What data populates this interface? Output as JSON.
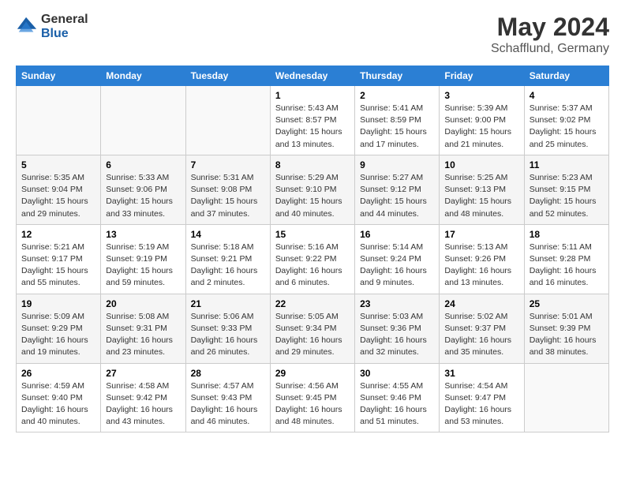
{
  "header": {
    "logo_general": "General",
    "logo_blue": "Blue",
    "month": "May 2024",
    "location": "Schafflund, Germany"
  },
  "weekdays": [
    "Sunday",
    "Monday",
    "Tuesday",
    "Wednesday",
    "Thursday",
    "Friday",
    "Saturday"
  ],
  "weeks": [
    [
      {
        "day": "",
        "info": ""
      },
      {
        "day": "",
        "info": ""
      },
      {
        "day": "",
        "info": ""
      },
      {
        "day": "1",
        "info": "Sunrise: 5:43 AM\nSunset: 8:57 PM\nDaylight: 15 hours\nand 13 minutes."
      },
      {
        "day": "2",
        "info": "Sunrise: 5:41 AM\nSunset: 8:59 PM\nDaylight: 15 hours\nand 17 minutes."
      },
      {
        "day": "3",
        "info": "Sunrise: 5:39 AM\nSunset: 9:00 PM\nDaylight: 15 hours\nand 21 minutes."
      },
      {
        "day": "4",
        "info": "Sunrise: 5:37 AM\nSunset: 9:02 PM\nDaylight: 15 hours\nand 25 minutes."
      }
    ],
    [
      {
        "day": "5",
        "info": "Sunrise: 5:35 AM\nSunset: 9:04 PM\nDaylight: 15 hours\nand 29 minutes."
      },
      {
        "day": "6",
        "info": "Sunrise: 5:33 AM\nSunset: 9:06 PM\nDaylight: 15 hours\nand 33 minutes."
      },
      {
        "day": "7",
        "info": "Sunrise: 5:31 AM\nSunset: 9:08 PM\nDaylight: 15 hours\nand 37 minutes."
      },
      {
        "day": "8",
        "info": "Sunrise: 5:29 AM\nSunset: 9:10 PM\nDaylight: 15 hours\nand 40 minutes."
      },
      {
        "day": "9",
        "info": "Sunrise: 5:27 AM\nSunset: 9:12 PM\nDaylight: 15 hours\nand 44 minutes."
      },
      {
        "day": "10",
        "info": "Sunrise: 5:25 AM\nSunset: 9:13 PM\nDaylight: 15 hours\nand 48 minutes."
      },
      {
        "day": "11",
        "info": "Sunrise: 5:23 AM\nSunset: 9:15 PM\nDaylight: 15 hours\nand 52 minutes."
      }
    ],
    [
      {
        "day": "12",
        "info": "Sunrise: 5:21 AM\nSunset: 9:17 PM\nDaylight: 15 hours\nand 55 minutes."
      },
      {
        "day": "13",
        "info": "Sunrise: 5:19 AM\nSunset: 9:19 PM\nDaylight: 15 hours\nand 59 minutes."
      },
      {
        "day": "14",
        "info": "Sunrise: 5:18 AM\nSunset: 9:21 PM\nDaylight: 16 hours\nand 2 minutes."
      },
      {
        "day": "15",
        "info": "Sunrise: 5:16 AM\nSunset: 9:22 PM\nDaylight: 16 hours\nand 6 minutes."
      },
      {
        "day": "16",
        "info": "Sunrise: 5:14 AM\nSunset: 9:24 PM\nDaylight: 16 hours\nand 9 minutes."
      },
      {
        "day": "17",
        "info": "Sunrise: 5:13 AM\nSunset: 9:26 PM\nDaylight: 16 hours\nand 13 minutes."
      },
      {
        "day": "18",
        "info": "Sunrise: 5:11 AM\nSunset: 9:28 PM\nDaylight: 16 hours\nand 16 minutes."
      }
    ],
    [
      {
        "day": "19",
        "info": "Sunrise: 5:09 AM\nSunset: 9:29 PM\nDaylight: 16 hours\nand 19 minutes."
      },
      {
        "day": "20",
        "info": "Sunrise: 5:08 AM\nSunset: 9:31 PM\nDaylight: 16 hours\nand 23 minutes."
      },
      {
        "day": "21",
        "info": "Sunrise: 5:06 AM\nSunset: 9:33 PM\nDaylight: 16 hours\nand 26 minutes."
      },
      {
        "day": "22",
        "info": "Sunrise: 5:05 AM\nSunset: 9:34 PM\nDaylight: 16 hours\nand 29 minutes."
      },
      {
        "day": "23",
        "info": "Sunrise: 5:03 AM\nSunset: 9:36 PM\nDaylight: 16 hours\nand 32 minutes."
      },
      {
        "day": "24",
        "info": "Sunrise: 5:02 AM\nSunset: 9:37 PM\nDaylight: 16 hours\nand 35 minutes."
      },
      {
        "day": "25",
        "info": "Sunrise: 5:01 AM\nSunset: 9:39 PM\nDaylight: 16 hours\nand 38 minutes."
      }
    ],
    [
      {
        "day": "26",
        "info": "Sunrise: 4:59 AM\nSunset: 9:40 PM\nDaylight: 16 hours\nand 40 minutes."
      },
      {
        "day": "27",
        "info": "Sunrise: 4:58 AM\nSunset: 9:42 PM\nDaylight: 16 hours\nand 43 minutes."
      },
      {
        "day": "28",
        "info": "Sunrise: 4:57 AM\nSunset: 9:43 PM\nDaylight: 16 hours\nand 46 minutes."
      },
      {
        "day": "29",
        "info": "Sunrise: 4:56 AM\nSunset: 9:45 PM\nDaylight: 16 hours\nand 48 minutes."
      },
      {
        "day": "30",
        "info": "Sunrise: 4:55 AM\nSunset: 9:46 PM\nDaylight: 16 hours\nand 51 minutes."
      },
      {
        "day": "31",
        "info": "Sunrise: 4:54 AM\nSunset: 9:47 PM\nDaylight: 16 hours\nand 53 minutes."
      },
      {
        "day": "",
        "info": ""
      }
    ]
  ]
}
